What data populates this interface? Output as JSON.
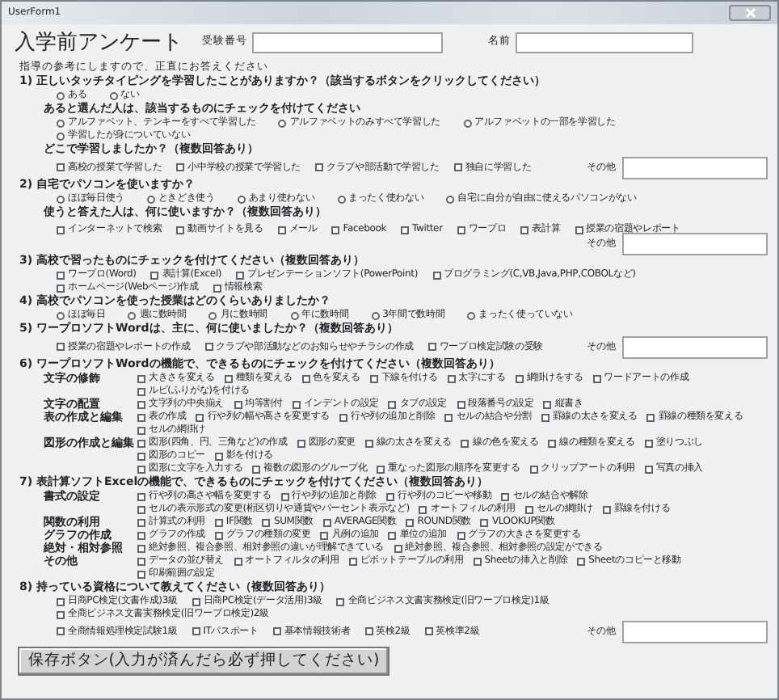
{
  "window": {
    "title": "UserForm1"
  },
  "header": {
    "title": "入学前アンケート",
    "fields": [
      {
        "label": "受験番号"
      },
      {
        "label": "名前"
      }
    ]
  },
  "intro": "指導の参考にしますので、正直にお答えください",
  "blocks": [
    {
      "kind": "question",
      "text": "1) 正しいタッチタイピングを学習したことがありますか？（該当するボタンをクリックしてください）"
    },
    {
      "kind": "radios",
      "options": [
        {
          "label": "ある",
          "selected": false
        },
        {
          "label": "ない",
          "selected": false
        }
      ]
    },
    {
      "kind": "subquestion",
      "text": "あると選んだ人は、該当するものにチェックを付けてください"
    },
    {
      "kind": "radios",
      "options": [
        {
          "label": "アルファベット、テンキーをすべて学習した",
          "selected": false
        },
        {
          "label": "アルファベットのみすべて学習した",
          "selected": false
        },
        {
          "label": "アルファベットの一部を学習した",
          "selected": false
        },
        {
          "label": "学習したが身についていない",
          "selected": false
        }
      ]
    },
    {
      "kind": "subquestion",
      "text": "どこで学習しましたか？（複数回答あり）"
    },
    {
      "kind": "checks",
      "options": [
        {
          "label": "高校の授業で学習した",
          "checked": false
        },
        {
          "label": "小中学校の授業で学習した",
          "checked": false
        },
        {
          "label": "クラブや部活動で学習した",
          "checked": false
        },
        {
          "label": "独自に学習した",
          "checked": false
        }
      ],
      "other": {
        "label": "その他"
      }
    },
    {
      "kind": "question",
      "text": "2) 自宅でパソコンを使いますか？"
    },
    {
      "kind": "radios",
      "options": [
        {
          "label": "ほぼ毎日使う",
          "selected": false
        },
        {
          "label": "ときどき使う",
          "selected": false
        },
        {
          "label": "あまり使わない",
          "selected": false
        },
        {
          "label": "まったく使わない",
          "selected": false
        },
        {
          "label": "自宅に自分が自由に使えるパソコンがない",
          "selected": false
        }
      ]
    },
    {
      "kind": "subquestion",
      "text": "使うと答えた人は、何に使いますか？（複数回答あり）"
    },
    {
      "kind": "checks",
      "options": [
        {
          "label": "インターネットで検索",
          "checked": false
        },
        {
          "label": "動画サイトを見る",
          "checked": false
        },
        {
          "label": "メール",
          "checked": false
        },
        {
          "label": "Facebook",
          "checked": false
        },
        {
          "label": "Twitter",
          "checked": false
        },
        {
          "label": "ワープロ",
          "checked": false
        },
        {
          "label": "表計算",
          "checked": false
        },
        {
          "label": "授業の宿題やレポート",
          "checked": false
        }
      ],
      "other": {
        "label": "その他"
      }
    },
    {
      "kind": "question",
      "text": "3) 高校で習ったものにチェックを付けてください（複数回答あり）"
    },
    {
      "kind": "checks",
      "options": [
        {
          "label": "ワープロ(Word)",
          "checked": false
        },
        {
          "label": "表計算(Excel)",
          "checked": false
        },
        {
          "label": "プレゼンテーションソフト(PowerPoint)",
          "checked": false
        },
        {
          "label": "プログラミング(C,VB,Java,PHP,COBOLなど)",
          "checked": false
        },
        {
          "label": "ホームページ(Webページ)作成",
          "checked": false
        },
        {
          "label": "情報検索",
          "checked": false
        }
      ]
    },
    {
      "kind": "question",
      "text": "4) 高校でパソコンを使った授業はどのくらいありましたか？"
    },
    {
      "kind": "radios",
      "options": [
        {
          "label": "ほぼ毎日",
          "selected": false
        },
        {
          "label": "週に数時間",
          "selected": false
        },
        {
          "label": "月に数時間",
          "selected": false
        },
        {
          "label": "年に数時間",
          "selected": false
        },
        {
          "label": "3年間で数時間",
          "selected": false
        },
        {
          "label": "まったく使っていない",
          "selected": false
        }
      ]
    },
    {
      "kind": "question",
      "text": "5) ワープロソフトWordは、主に、何に使いましたか？（複数回答あり）"
    },
    {
      "kind": "checks",
      "options": [
        {
          "label": "授業の宿題やレポートの作成",
          "checked": false
        },
        {
          "label": "クラブや部活動などのお知らせやチラシの作成",
          "checked": false
        },
        {
          "label": "ワープロ検定試験の受験",
          "checked": false
        }
      ],
      "other": {
        "label": "その他"
      }
    },
    {
      "kind": "question",
      "text": "6) ワープロソフトWordの機能で、できるものにチェックを付けてください（複数回答あり）"
    },
    {
      "kind": "group",
      "label": "文字の修飾",
      "options": [
        {
          "label": "大きさを変える",
          "checked": false
        },
        {
          "label": "種類を変える",
          "checked": false
        },
        {
          "label": "色を変える",
          "checked": false
        },
        {
          "label": "下線を付ける",
          "checked": false
        },
        {
          "label": "太字にする",
          "checked": false
        },
        {
          "label": "網掛けをする",
          "checked": false
        },
        {
          "label": "ワードアートの作成",
          "checked": false
        },
        {
          "label": "ルビ(ふりがな)を付ける",
          "checked": false
        }
      ]
    },
    {
      "kind": "group",
      "label": "文字の配置",
      "options": [
        {
          "label": "文字列の中央揃え",
          "checked": false
        },
        {
          "label": "均等割付",
          "checked": false
        },
        {
          "label": "インデントの設定",
          "checked": false
        },
        {
          "label": "タブの設定",
          "checked": false
        },
        {
          "label": "段落番号の設定",
          "checked": false
        },
        {
          "label": "縦書き",
          "checked": false
        }
      ]
    },
    {
      "kind": "group",
      "label": "表の作成と編集",
      "options": [
        {
          "label": "表の作成",
          "checked": false
        },
        {
          "label": "行や列の幅や高さを変更する",
          "checked": false
        },
        {
          "label": "行や列の追加と削除",
          "checked": false
        },
        {
          "label": "セルの結合や分割",
          "checked": false
        },
        {
          "label": "罫線の太さを変える",
          "checked": false
        },
        {
          "label": "罫線の種類を変える",
          "checked": false
        },
        {
          "label": "セルの網掛け",
          "checked": false
        }
      ]
    },
    {
      "kind": "group",
      "label": "図形の作成と編集",
      "options": [
        {
          "label": "図形(四角、円、三角など)の作成",
          "checked": false
        },
        {
          "label": "図形の変更",
          "checked": false
        },
        {
          "label": "線の太さを変える",
          "checked": false
        },
        {
          "label": "線の色を変える",
          "checked": false
        },
        {
          "label": "線の種類を変える",
          "checked": false
        },
        {
          "label": "塗りつぶし",
          "checked": false
        },
        {
          "label": "図形のコピー",
          "checked": false
        },
        {
          "label": "影を付ける",
          "checked": false
        }
      ]
    },
    {
      "kind": "more",
      "options": [
        {
          "label": "図形に文字を入力する",
          "checked": false
        },
        {
          "label": "複数の図形のグループ化",
          "checked": false
        },
        {
          "label": "重なった図形の順序を変更する",
          "checked": false
        },
        {
          "label": "クリップアートの利用",
          "checked": false
        },
        {
          "label": "写真の挿入",
          "checked": false
        }
      ]
    },
    {
      "kind": "question",
      "text": "7) 表計算ソフトExcelの機能で、できるものにチェックを付けてください（複数回答あり）"
    },
    {
      "kind": "group",
      "label": "書式の設定",
      "options": [
        {
          "label": "行や列の高さや幅を変更する",
          "checked": false
        },
        {
          "label": "行や列の追加と削除",
          "checked": false
        },
        {
          "label": "行や列のコピーや移動",
          "checked": false
        },
        {
          "label": "セルの結合や解除",
          "checked": false
        }
      ]
    },
    {
      "kind": "more",
      "options": [
        {
          "label": "セルの表示形式の変更(桁区切りや通貨やパーセント表示など)",
          "checked": false
        },
        {
          "label": "オートフィルの利用",
          "checked": false
        },
        {
          "label": "セルの網掛け",
          "checked": false
        },
        {
          "label": "罫線を付ける",
          "checked": false
        }
      ]
    },
    {
      "kind": "group",
      "label": "関数の利用",
      "options": [
        {
          "label": "計算式の利用",
          "checked": false
        },
        {
          "label": "IF関数",
          "checked": false
        },
        {
          "label": "SUM関数",
          "checked": false
        },
        {
          "label": "AVERAGE関数",
          "checked": false
        },
        {
          "label": "ROUND関数",
          "checked": false
        },
        {
          "label": "VLOOKUP関数",
          "checked": false
        }
      ]
    },
    {
      "kind": "group",
      "label": "グラフの作成",
      "options": [
        {
          "label": "グラフの作成",
          "checked": false
        },
        {
          "label": "グラフの種類の変更",
          "checked": false
        },
        {
          "label": "凡例の追加",
          "checked": false
        },
        {
          "label": "単位の追加",
          "checked": false
        },
        {
          "label": "グラフの大きさを変更する",
          "checked": false
        }
      ]
    },
    {
      "kind": "group",
      "label": "絶対・相対参照",
      "options": [
        {
          "label": "絶対参照、複合参照、相対参照の違いが理解できている",
          "checked": false
        },
        {
          "label": "絶対参照、複合参照、相対参照の設定ができる",
          "checked": false
        }
      ]
    },
    {
      "kind": "group",
      "label": "その他",
      "options": [
        {
          "label": "データの並び替え",
          "checked": false
        },
        {
          "label": "オートフィルタの利用",
          "checked": false
        },
        {
          "label": "ピボットテーブルの利用",
          "checked": false
        },
        {
          "label": "Sheetの挿入と削除",
          "checked": false
        },
        {
          "label": "Sheetのコピーと移動",
          "checked": false
        },
        {
          "label": "印刷範囲の設定",
          "checked": false
        }
      ]
    },
    {
      "kind": "question",
      "text": "8) 持っている資格について教えてください（複数回答あり）"
    },
    {
      "kind": "checks",
      "options": [
        {
          "label": "日商PC検定(文書作成)3級",
          "checked": false
        },
        {
          "label": "日商PC検定(データ活用)3級",
          "checked": false
        },
        {
          "label": "全商ビジネス文書実務検定(旧ワープロ検定)1級",
          "checked": false
        },
        {
          "label": "全商ビジネス文書実務検定(旧ワープロ検定)2級",
          "checked": false
        }
      ]
    },
    {
      "kind": "checks",
      "options": [
        {
          "label": "全商情報処理検定試験1級",
          "checked": false
        },
        {
          "label": "ITパスポート",
          "checked": false
        },
        {
          "label": "基本情報技術者",
          "checked": false
        },
        {
          "label": "英検2級",
          "checked": false
        },
        {
          "label": "英検準2級",
          "checked": false
        }
      ],
      "other": {
        "label": "その他"
      }
    }
  ],
  "button": {
    "label": "保存ボタン(入力が済んだら必ず押してください)"
  }
}
